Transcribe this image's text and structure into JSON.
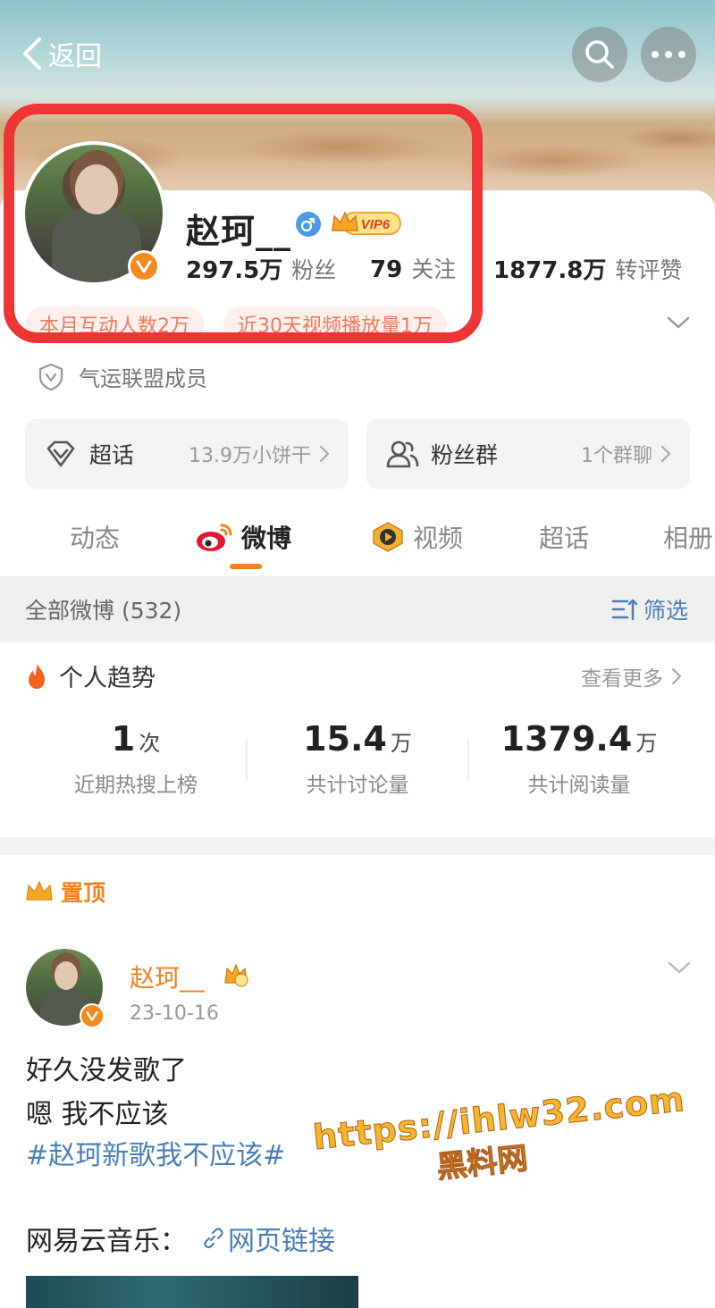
{
  "header": {
    "back_label": "返回"
  },
  "profile": {
    "name": "赵珂__",
    "vip_label": "VIP6",
    "stats": [
      {
        "num": "297.5万",
        "label": "粉丝"
      },
      {
        "num": "79",
        "label": "关注"
      },
      {
        "num": "1877.8万",
        "label": "转评赞"
      }
    ],
    "tags": [
      "本月互动人数2万",
      "近30天视频播放量1万"
    ],
    "alliance": "气运联盟成员"
  },
  "shortcuts": {
    "chaohua": {
      "title": "超话",
      "sub": "13.9万小饼干"
    },
    "fans": {
      "title": "粉丝群",
      "sub": "1个群聊"
    }
  },
  "tabs": [
    {
      "label": "动态"
    },
    {
      "label": "微博"
    },
    {
      "label": "视频"
    },
    {
      "label": "超话"
    },
    {
      "label": "相册"
    }
  ],
  "filter_bar": {
    "all_label": "全部微博 (532)",
    "filter_label": "筛选"
  },
  "trend": {
    "title": "个人趋势",
    "more": "查看更多",
    "stats": [
      {
        "value": "1",
        "unit": "次",
        "caption": "近期热搜上榜"
      },
      {
        "value": "15.4",
        "unit": "万",
        "caption": "共计讨论量"
      },
      {
        "value": "1379.4",
        "unit": "万",
        "caption": "共计阅读量"
      }
    ]
  },
  "post": {
    "pinned_label": "置顶",
    "author": "赵珂__",
    "date": "23-10-16",
    "line1": "好久没发歌了",
    "line2": "嗯 我不应该",
    "hashtag": "#赵珂新歌我不应该#",
    "music_prefix": "网易云音乐：",
    "link_label": "网页链接"
  },
  "watermark": {
    "line1": "https://ihlw32.com",
    "line2": "黑料网"
  },
  "colors": {
    "accent": "#f5821f",
    "link": "#4a7fb8",
    "highlight_box": "#ee3535"
  }
}
